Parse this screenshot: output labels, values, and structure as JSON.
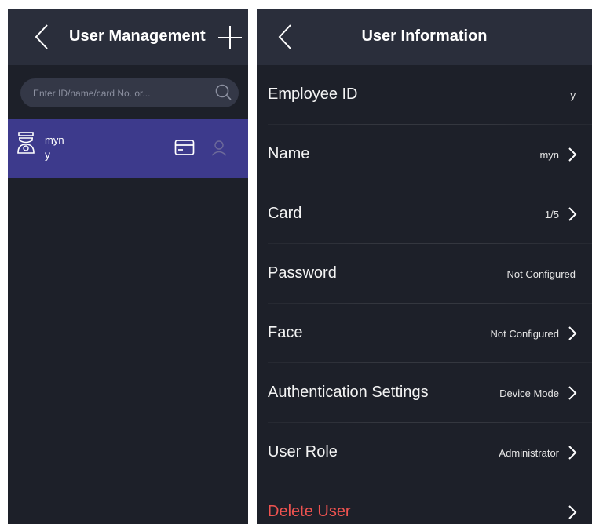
{
  "colors": {
    "background": "#1d2029",
    "header": "#2a2e3b",
    "selected_row": "#3d3a8c",
    "search_box": "#343847",
    "danger": "#ef5350"
  },
  "left_panel": {
    "back_icon": "chevron-left-icon",
    "title": "User Management",
    "add_icon": "plus-icon",
    "search": {
      "placeholder": "Enter ID/name/card No. or...",
      "value": "",
      "icon": "search-icon"
    },
    "users": [
      {
        "name": "myn",
        "id": "y",
        "avatar_icon": "administrator-avatar-icon",
        "credential_icons": [
          "card-icon",
          "face-icon"
        ]
      }
    ]
  },
  "right_panel": {
    "back_icon": "chevron-left-icon",
    "title": "User Information",
    "rows": [
      {
        "label": "Employee ID",
        "value": "y"
      },
      {
        "label": "Name",
        "value": "myn"
      },
      {
        "label": "Card",
        "value": "1/5"
      },
      {
        "label": "Password",
        "value": "Not Configured"
      },
      {
        "label": "Face",
        "value": "Not Configured"
      },
      {
        "label": "Authentication Settings",
        "value": "Device Mode"
      },
      {
        "label": "User Role",
        "value": "Administrator"
      },
      {
        "label": "Delete User",
        "value": ""
      }
    ]
  }
}
